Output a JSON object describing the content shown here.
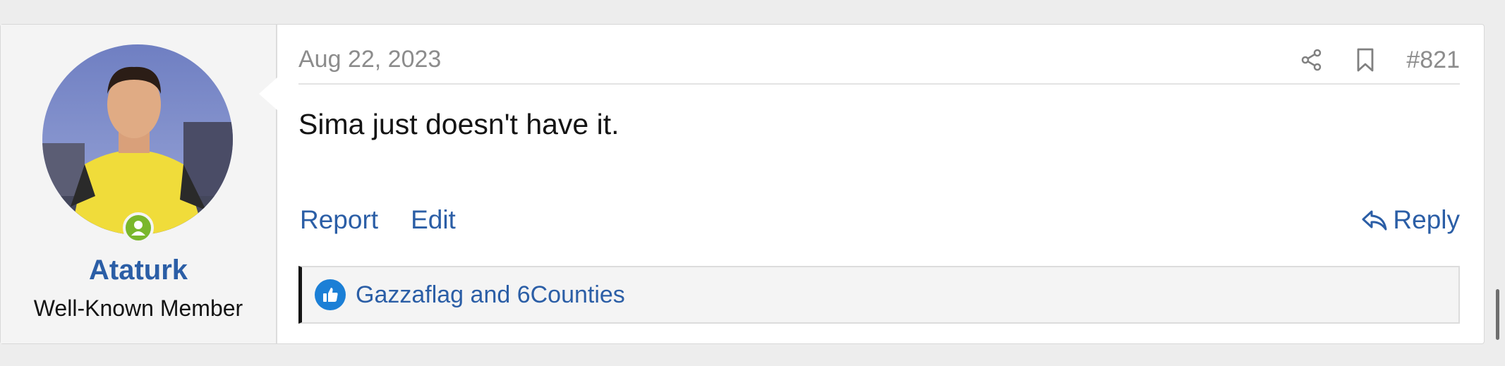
{
  "post": {
    "date": "Aug 22, 2023",
    "number": "#821",
    "message": "Sima just doesn't have it.",
    "actions": {
      "report": "Report",
      "edit": "Edit",
      "reply": "Reply"
    },
    "reactions_text": "Gazzaflag and 6Counties"
  },
  "user": {
    "name": "Ataturk",
    "title": "Well-Known Member",
    "online": true
  },
  "icons": {
    "share": "share-icon",
    "bookmark": "bookmark-icon",
    "reply": "reply-icon",
    "like": "thumbs-up-icon",
    "online": "user-online-icon"
  },
  "colors": {
    "link": "#2b5ea6",
    "online": "#7ab72b",
    "like": "#1b7fd6"
  }
}
